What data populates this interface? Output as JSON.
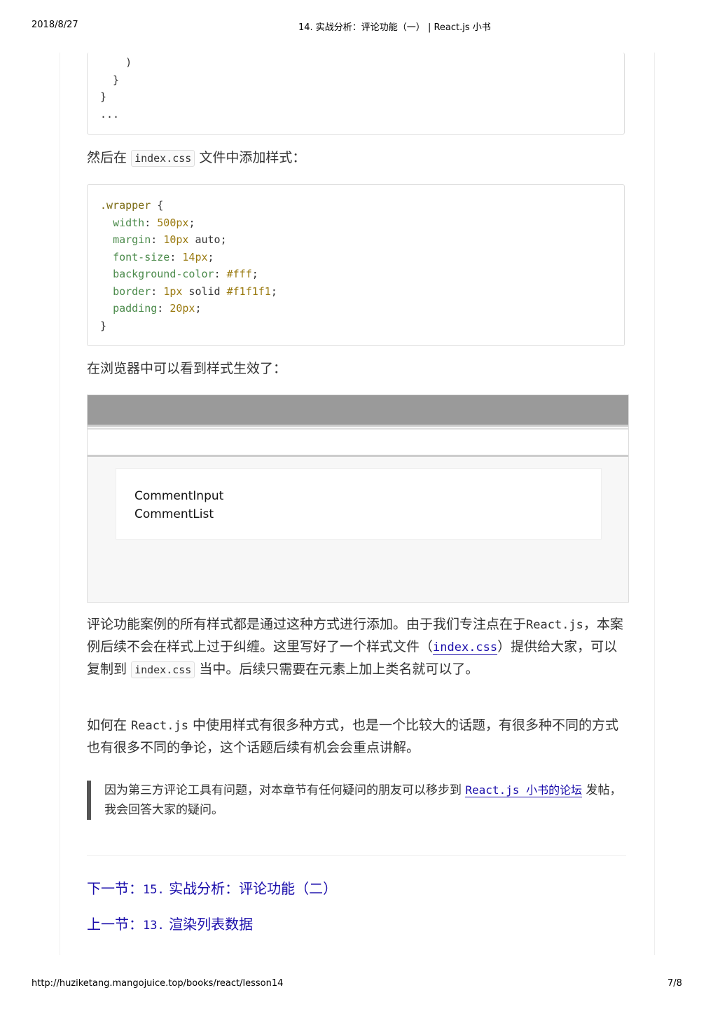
{
  "header": {
    "date": "2018/8/27",
    "title": "14. 实战分析：评论功能（一） | React.js 小书"
  },
  "footer": {
    "url": "http://huziketang.mangojuice.top/books/react/lesson14",
    "page": "7/8"
  },
  "code1": {
    "lines": [
      "    )",
      "  }",
      "}",
      "..."
    ]
  },
  "para1": {
    "before": "然后在",
    "code": "index.css",
    "after": "文件中添加样式："
  },
  "code2": {
    "selector": ".wrapper",
    "open": " {",
    "props": [
      [
        "width",
        "500px",
        ""
      ],
      [
        "margin",
        "10px",
        " auto"
      ],
      [
        "font-size",
        "14px",
        ""
      ],
      [
        "background-color",
        "#fff",
        ""
      ],
      [
        "border",
        "1px",
        " solid #f1f1f1"
      ],
      [
        "padding",
        "20px",
        ""
      ]
    ],
    "close": "}"
  },
  "para2": "在浏览器中可以看到样式生效了：",
  "preview": {
    "line1": "CommentInput",
    "line2": "CommentList"
  },
  "para3": {
    "t1": "评论功能案例的所有样式都是通过这种方式进行添加。由于我们专注点在于",
    "code1": "React.js",
    "t2": "，本案例后续不会在样式上过于纠缠。这里写好了一个样式文件（",
    "link": "index.css",
    "t3": "）提供给大家，可以复制到",
    "code2": "index.css",
    "t4": "当中。后续只需要在元素上加上类名就可以了。"
  },
  "para4": {
    "t1": "如何在",
    "code": "React.js",
    "t2": "中使用样式有很多种方式，也是一个比较大的话题，有很多种不同的方式也有很多不同的争论，这个话题后续有机会会重点讲解。"
  },
  "quote": {
    "t1": "因为第三方评论工具有问题，对本章节有任何疑问的朋友可以移步到",
    "link": "React.js 小书的论坛",
    "t2": "发帖，我会回答大家的疑问。"
  },
  "nav": {
    "next_label": "下一节：",
    "next_num": "15.",
    "next_title": "实战分析：评论功能（二）",
    "prev_label": "上一节：",
    "prev_num": "13.",
    "prev_title": "渲染列表数据"
  }
}
